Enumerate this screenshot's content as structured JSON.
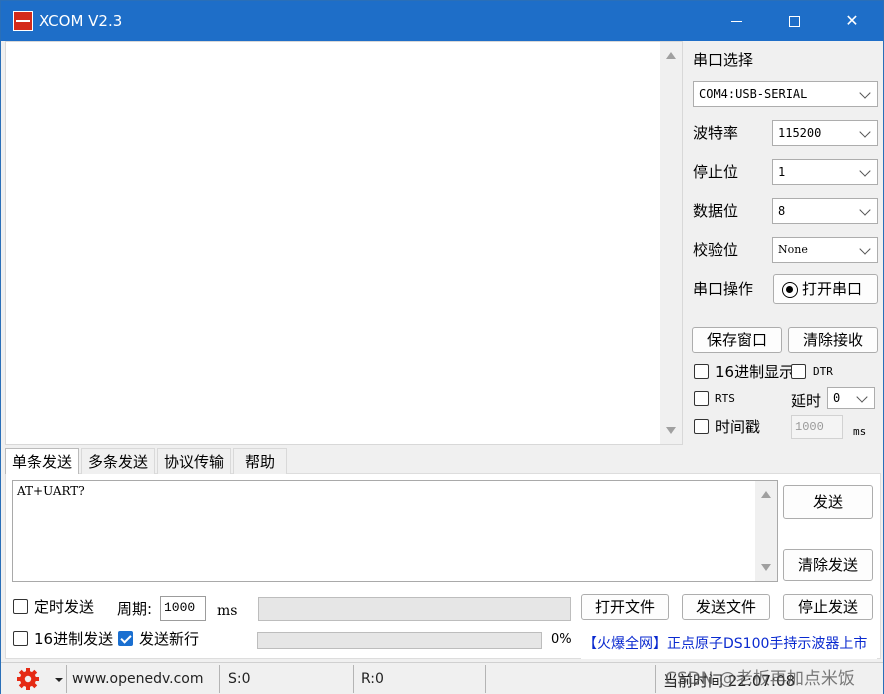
{
  "app": {
    "title": "XCOM V2.3",
    "icon": "xcom-app-icon"
  },
  "window_controls": {
    "minimize": "minimize-icon",
    "maximize": "maximize-icon",
    "close": "close-icon",
    "close_glyph": "✕"
  },
  "receive_area": {
    "content": ""
  },
  "settings": {
    "port_select_label": "串口选择",
    "port_value": "COM4:USB-SERIAL",
    "baud_label": "波特率",
    "baud_value": "115200",
    "stop_bits_label": "停止位",
    "stop_bits_value": "1",
    "data_bits_label": "数据位",
    "data_bits_value": "8",
    "parity_label": "校验位",
    "parity_value": "None",
    "port_op_label": "串口操作",
    "open_port_button": "打开串口"
  },
  "receive_controls": {
    "save_window": "保存窗口",
    "clear_receive": "清除接收",
    "hex_display": "16进制显示",
    "dtr": "DTR",
    "rts": "RTS",
    "delay_label": "延时",
    "delay_value": "0",
    "timestamp": "时间戳",
    "timestamp_value": "1000",
    "timestamp_unit": "ms"
  },
  "tabs": [
    {
      "label": "单条发送",
      "active": true
    },
    {
      "label": "多条发送",
      "active": false
    },
    {
      "label": "协议传输",
      "active": false
    },
    {
      "label": "帮助",
      "active": false
    }
  ],
  "send": {
    "text": "AT+UART?",
    "send_button": "发送",
    "clear_send_button": "清除发送",
    "timed_send": "定时发送",
    "period_label": "周期:",
    "period_value": "1000",
    "period_unit": "ms",
    "open_file": "打开文件",
    "send_file": "发送文件",
    "stop_send": "停止发送",
    "hex_send": "16进制发送",
    "send_newline": "发送新行",
    "send_newline_checked": true,
    "progress_percent": "0%",
    "progress_value": 0
  },
  "ad_banner": "【火爆全网】正点原子DS100手持示波器上市",
  "status": {
    "website": "www.openedv.com",
    "sent": "S:0",
    "received": "R:0",
    "time": "当前时间 22:07:08"
  },
  "watermark": "CSDN @老板再加点米饭",
  "colors": {
    "titlebar": "#1e6ec8",
    "ad_text": "#0a2ad0",
    "gear": "#e52a14",
    "checkbox_on": "#1a6fd0"
  }
}
